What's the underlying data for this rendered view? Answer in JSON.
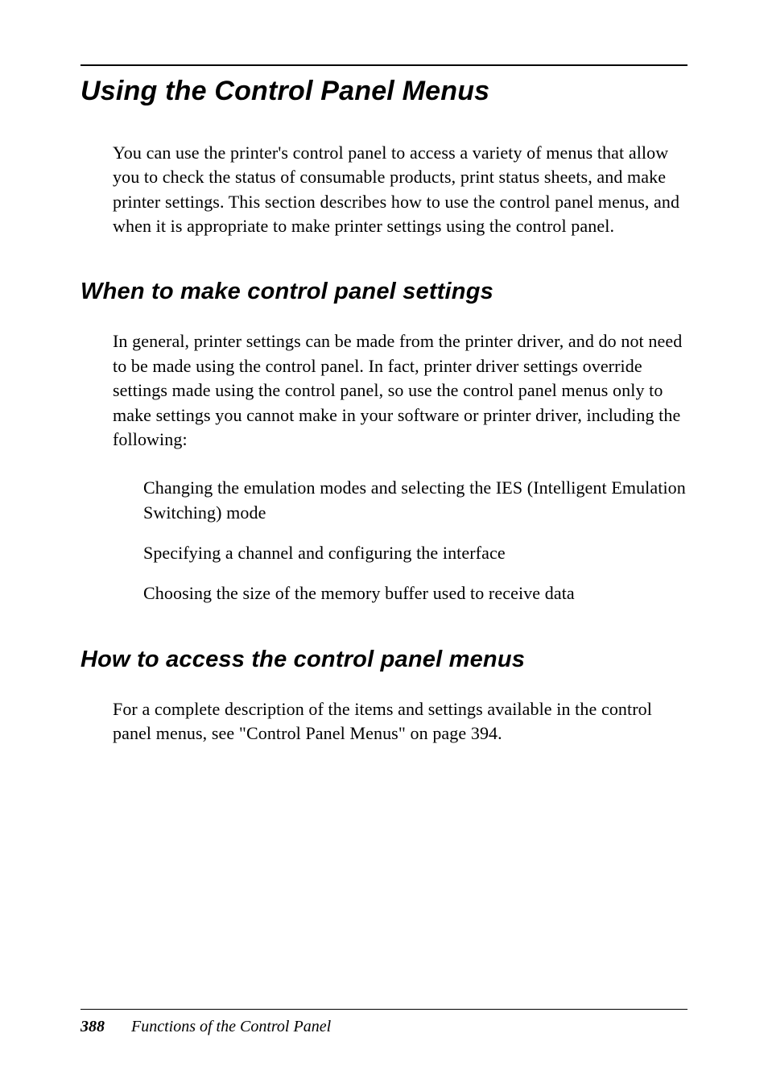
{
  "heading1": "Using the Control Panel Menus",
  "para1": "You can use the printer's control panel to access a variety of menus that allow you to check the status of consumable products, print status sheets, and make printer settings. This section describes how to use the control panel menus, and when it is appropriate to make printer settings using the control panel.",
  "heading2a": "When to make control panel settings",
  "para2": "In general, printer settings can be made from the printer driver, and do not need to be made using the control panel. In fact, printer driver settings override settings made using the control panel, so use the control panel menus only to make settings you cannot make in your software or printer driver, including the following:",
  "bullet1": "Changing the emulation modes and selecting the IES (Intelligent Emulation Switching) mode",
  "bullet2": "Specifying a channel and configuring the interface",
  "bullet3": "Choosing the size of the memory buffer used to receive data",
  "heading2b": "How to access the control panel menus",
  "para3": "For a complete description of the items and settings available in the control panel menus, see \"Control Panel Menus\" on page 394.",
  "footer": {
    "page_number": "388",
    "section_title": "Functions of the Control Panel"
  }
}
